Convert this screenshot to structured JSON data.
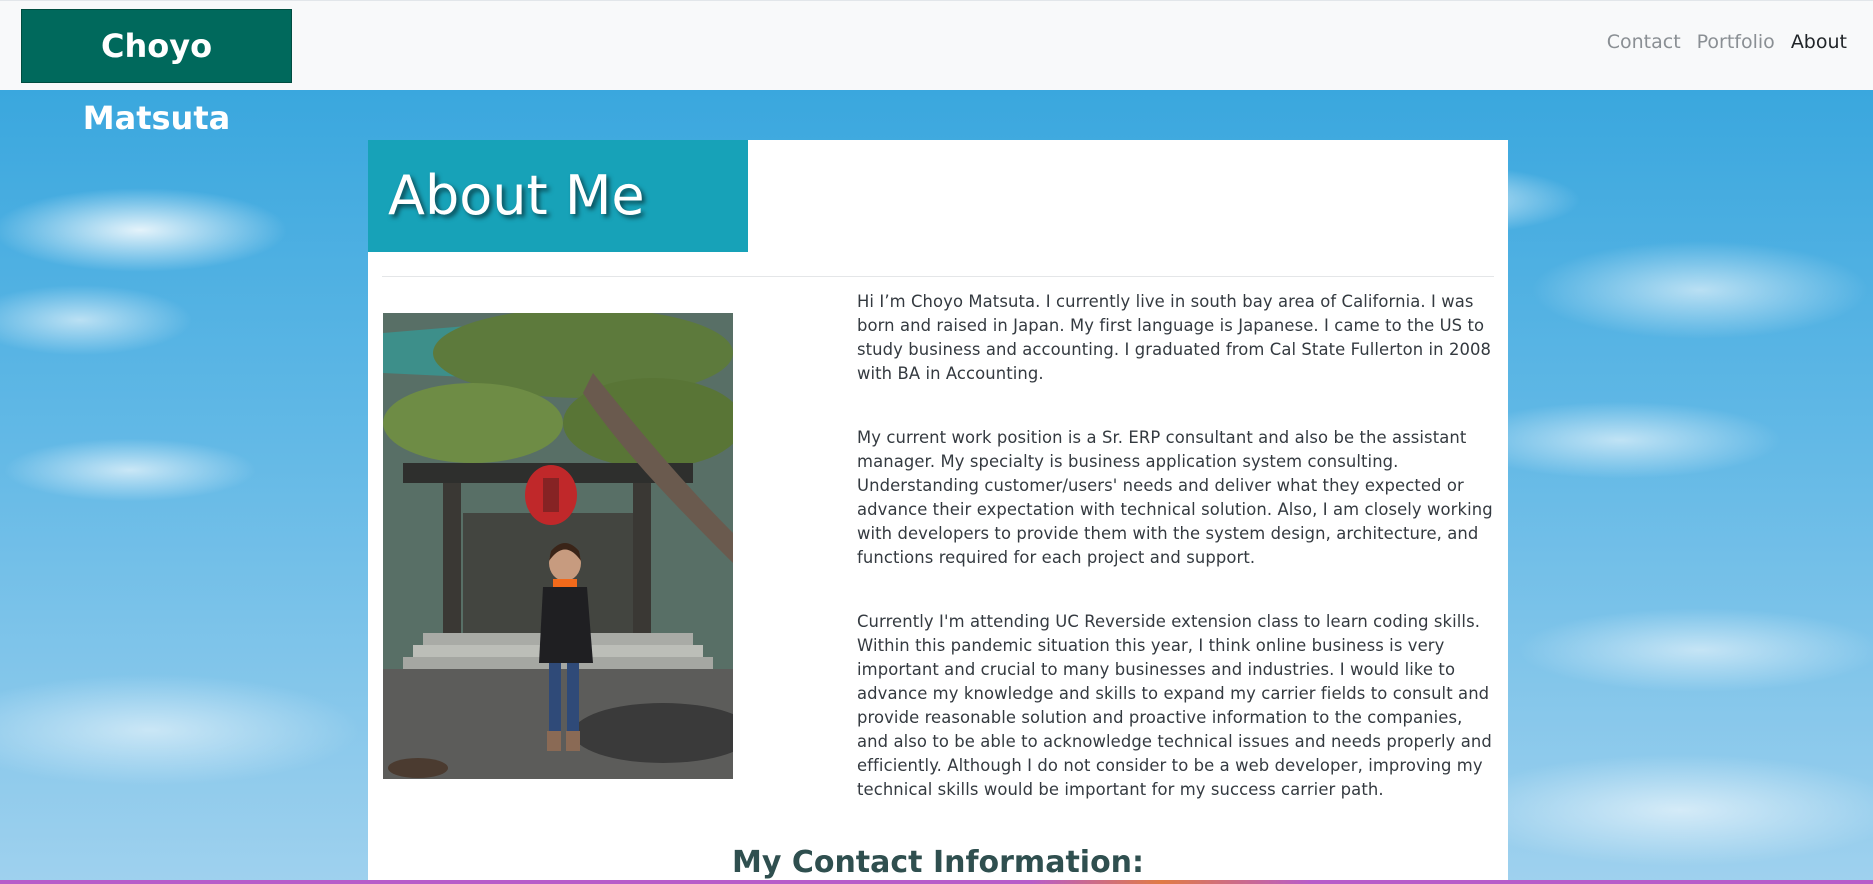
{
  "navbar": {
    "brand": "Choyo Matsuta",
    "links": [
      {
        "label": "Contact",
        "active": false
      },
      {
        "label": "Portfolio",
        "active": false
      },
      {
        "label": "About",
        "active": true
      }
    ]
  },
  "main": {
    "title": "About Me",
    "photo_icon": "profile-photo",
    "bio": [
      "Hi I’m Choyo Matsuta. I currently live in south bay area of California. I was born and raised in Japan. My first language is Japanese. I came to the US to study business and accounting. I graduated from Cal State Fullerton in 2008 with BA in Accounting.",
      "My current work position is a Sr. ERP consultant and also be the assistant manager. My specialty is business application system consulting. Understanding customer/users' needs and deliver what they expected or advance their expectation with technical solution. Also, I am closely working with developers to provide them with the system design, architecture, and functions required for each project and support.",
      "Currently I'm attending UC Reverside extension class to learn coding skills. Within this pandemic situation this year, I think online business is very important and crucial to many businesses and industries. I would like to advance my knowledge and skills to expand my carrier fields to consult and provide reasonable solution and proactive information to the companies, and also to be able to acknowledge technical issues and needs properly and efficiently. Although I do not consider to be a web developer, improving my technical skills would be important for my success carrier path."
    ],
    "contact_heading": "My Contact Information:"
  },
  "colors": {
    "brand_bg": "#00695c",
    "title_bg": "#17a2b8",
    "heading_text": "#2f4f4f"
  }
}
